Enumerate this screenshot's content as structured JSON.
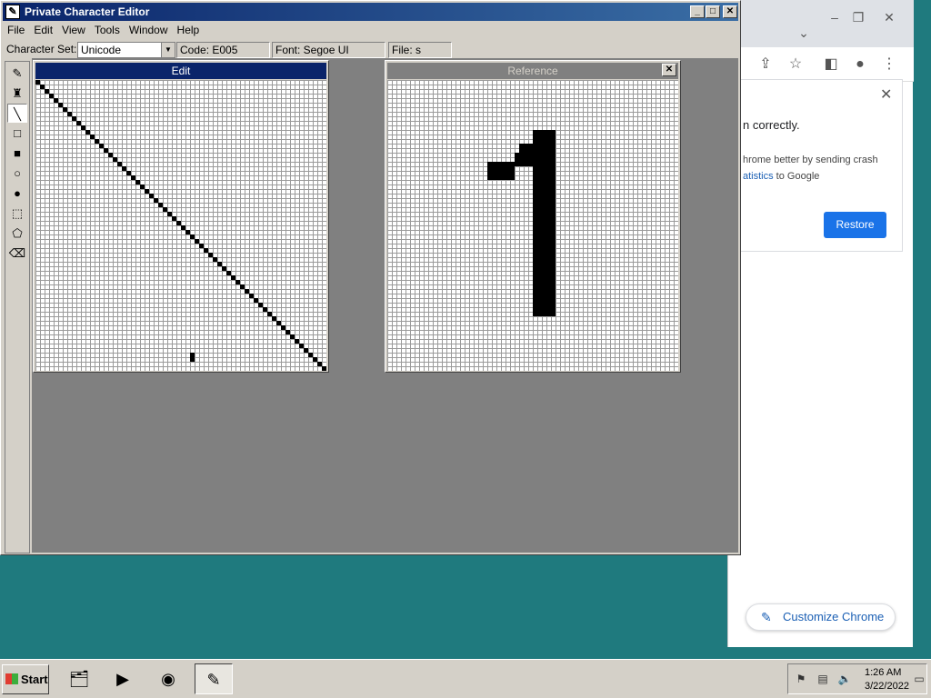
{
  "chrome": {
    "crash_title": "n correctly.",
    "crash_text1": "hrome better by sending crash",
    "crash_link": "atistics",
    "crash_text2_suffix": " to Google",
    "restore_label": "Restore",
    "customize_label": "Customize Chrome"
  },
  "editor": {
    "title": "Private Character Editor",
    "menu": [
      "File",
      "Edit",
      "View",
      "Tools",
      "Window",
      "Help"
    ],
    "charset_label": "Character Set:",
    "charset_value": "Unicode",
    "code": "Code: E005",
    "font": "Font: Segoe UI",
    "file": "File: s",
    "edit_title": "Edit",
    "reference_title": "Reference",
    "tools": [
      "pencil",
      "brush",
      "line",
      "hollow-rectangle",
      "filled-rectangle",
      "hollow-ellipse",
      "filled-ellipse",
      "rectangular-selection",
      "freeform-selection",
      "eraser"
    ],
    "active_tool": "line"
  },
  "taskbar": {
    "start_label": "Start",
    "apps": [
      "explorer",
      "media-player",
      "chrome",
      "private-character-editor"
    ],
    "time": "1:26 AM",
    "date": "3/22/2022"
  }
}
